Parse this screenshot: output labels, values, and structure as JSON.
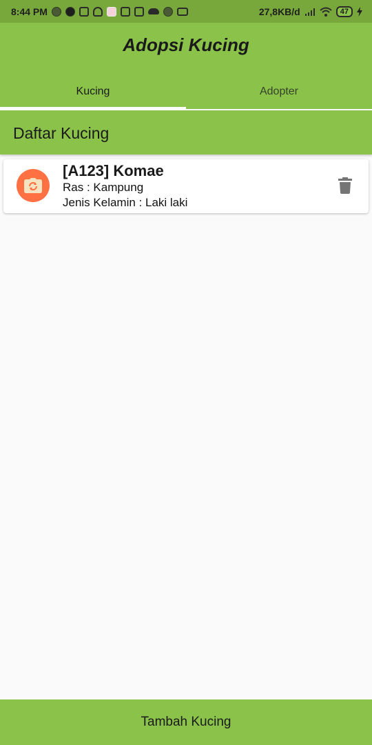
{
  "status_bar": {
    "time": "8:44 PM",
    "network_speed": "27,8KB/d",
    "battery_level": "47",
    "icons": [
      "notification-dot-icon",
      "whatsapp-icon",
      "clipboard-icon",
      "rabbit-icon",
      "pink-app-icon",
      "instagram-icon",
      "instagram-icon",
      "cloud-icon",
      "notification-dot-icon",
      "chat-icon",
      "signal-icon",
      "wifi-icon",
      "battery-icon",
      "charging-icon"
    ]
  },
  "app_bar": {
    "title": "Adopsi Kucing",
    "color": "#8bc34a"
  },
  "tabs": [
    {
      "label": "Kucing",
      "active": true
    },
    {
      "label": "Adopter",
      "active": false
    }
  ],
  "section": {
    "title": "Daftar Kucing"
  },
  "cats": [
    {
      "title": "[A123] Komae",
      "ras": "Ras : Kampung",
      "jenis_kelamin": "Jenis Kelamin : Laki laki",
      "avatar_icon": "camera-switch-icon",
      "avatar_color": "#ff7043",
      "delete_icon": "trash-icon"
    }
  ],
  "bottom_button": {
    "label": "Tambah Kucing"
  }
}
